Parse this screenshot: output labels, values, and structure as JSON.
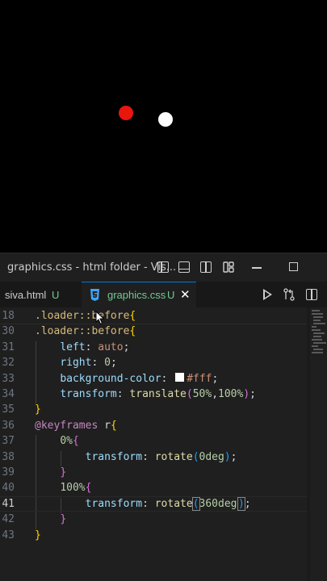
{
  "window": {
    "title": "graphics.css - html folder - Vis..."
  },
  "tabs": [
    {
      "name": "siva.html",
      "status": "U"
    },
    {
      "name": "graphics.css",
      "status": "U",
      "close": "✕"
    }
  ],
  "icons": [
    "layout-sidebar-icon",
    "layout-panel-icon",
    "layout-secondary-icon",
    "customize-layout-icon",
    "minimize-icon",
    "maximize-icon",
    "css-icon",
    "close-icon",
    "run-icon",
    "compare-icon",
    "split-editor-icon"
  ],
  "colors": {
    "accent": "#0078d4",
    "untracked": "#73c991",
    "dot_red": "#e8160c",
    "dot_white": "#ffffff"
  },
  "editor": {
    "sticky": {
      "num": "18",
      "parts": [
        [
          ".loader::before",
          "sel"
        ],
        [
          "{",
          "b1"
        ]
      ]
    },
    "lines": [
      {
        "num": "30",
        "parts": [
          [
            ".loader::before",
            "sel"
          ],
          [
            "{",
            "b1"
          ]
        ]
      },
      {
        "num": "31",
        "parts": [
          [
            "    ",
            "pun"
          ],
          [
            "left",
            "prop"
          ],
          [
            ": ",
            "pun"
          ],
          [
            "auto",
            "val"
          ],
          [
            ";",
            "pun"
          ]
        ]
      },
      {
        "num": "32",
        "parts": [
          [
            "    ",
            "pun"
          ],
          [
            "right",
            "prop"
          ],
          [
            ": ",
            "pun"
          ],
          [
            "0",
            "num"
          ],
          [
            ";",
            "pun"
          ]
        ]
      },
      {
        "num": "33",
        "parts": [
          [
            "    ",
            "pun"
          ],
          [
            "background-color",
            "prop"
          ],
          [
            ": ",
            "pun"
          ],
          [
            "",
            "swatch"
          ],
          [
            "#fff",
            "val"
          ],
          [
            ";",
            "pun"
          ]
        ]
      },
      {
        "num": "34",
        "parts": [
          [
            "    ",
            "pun"
          ],
          [
            "transform",
            "prop"
          ],
          [
            ": ",
            "pun"
          ],
          [
            "translate",
            "fn"
          ],
          [
            "(",
            "b2"
          ],
          [
            "50%",
            "num"
          ],
          [
            ",",
            "pun"
          ],
          [
            "100%",
            "num"
          ],
          [
            ")",
            "b2"
          ],
          [
            ";",
            "pun"
          ]
        ]
      },
      {
        "num": "35",
        "parts": [
          [
            "}",
            "b1"
          ]
        ]
      },
      {
        "num": "36",
        "parts": [
          [
            "@keyframes",
            "at"
          ],
          [
            " ",
            "pun"
          ],
          [
            "r",
            "id"
          ],
          [
            "{",
            "b1"
          ]
        ]
      },
      {
        "num": "37",
        "parts": [
          [
            "    ",
            "pun"
          ],
          [
            "0%",
            "num"
          ],
          [
            "{",
            "b2"
          ]
        ]
      },
      {
        "num": "38",
        "parts": [
          [
            "        ",
            "pun"
          ],
          [
            "transform",
            "prop"
          ],
          [
            ": ",
            "pun"
          ],
          [
            "rotate",
            "fn"
          ],
          [
            "(",
            "b3"
          ],
          [
            "0deg",
            "num"
          ],
          [
            ")",
            "b3"
          ],
          [
            ";",
            "pun"
          ]
        ]
      },
      {
        "num": "39",
        "parts": [
          [
            "    ",
            "pun"
          ],
          [
            "}",
            "b2"
          ]
        ]
      },
      {
        "num": "40",
        "parts": [
          [
            "    ",
            "pun"
          ],
          [
            "100%",
            "num"
          ],
          [
            "{",
            "b2"
          ]
        ]
      },
      {
        "num": "41",
        "active": true,
        "parts": [
          [
            "        ",
            "pun"
          ],
          [
            "transform",
            "prop"
          ],
          [
            ": ",
            "pun"
          ],
          [
            "rotate",
            "fn"
          ],
          [
            "(",
            "b3 bracket-box"
          ],
          [
            "360deg",
            "num"
          ],
          [
            "",
            "caret"
          ],
          [
            ")",
            "b3 bracket-box"
          ],
          [
            ";",
            "pun"
          ]
        ]
      },
      {
        "num": "42",
        "parts": [
          [
            "    ",
            "pun"
          ],
          [
            "}",
            "b2"
          ]
        ]
      },
      {
        "num": "43",
        "parts": [
          [
            "}",
            "b1"
          ]
        ]
      }
    ]
  }
}
